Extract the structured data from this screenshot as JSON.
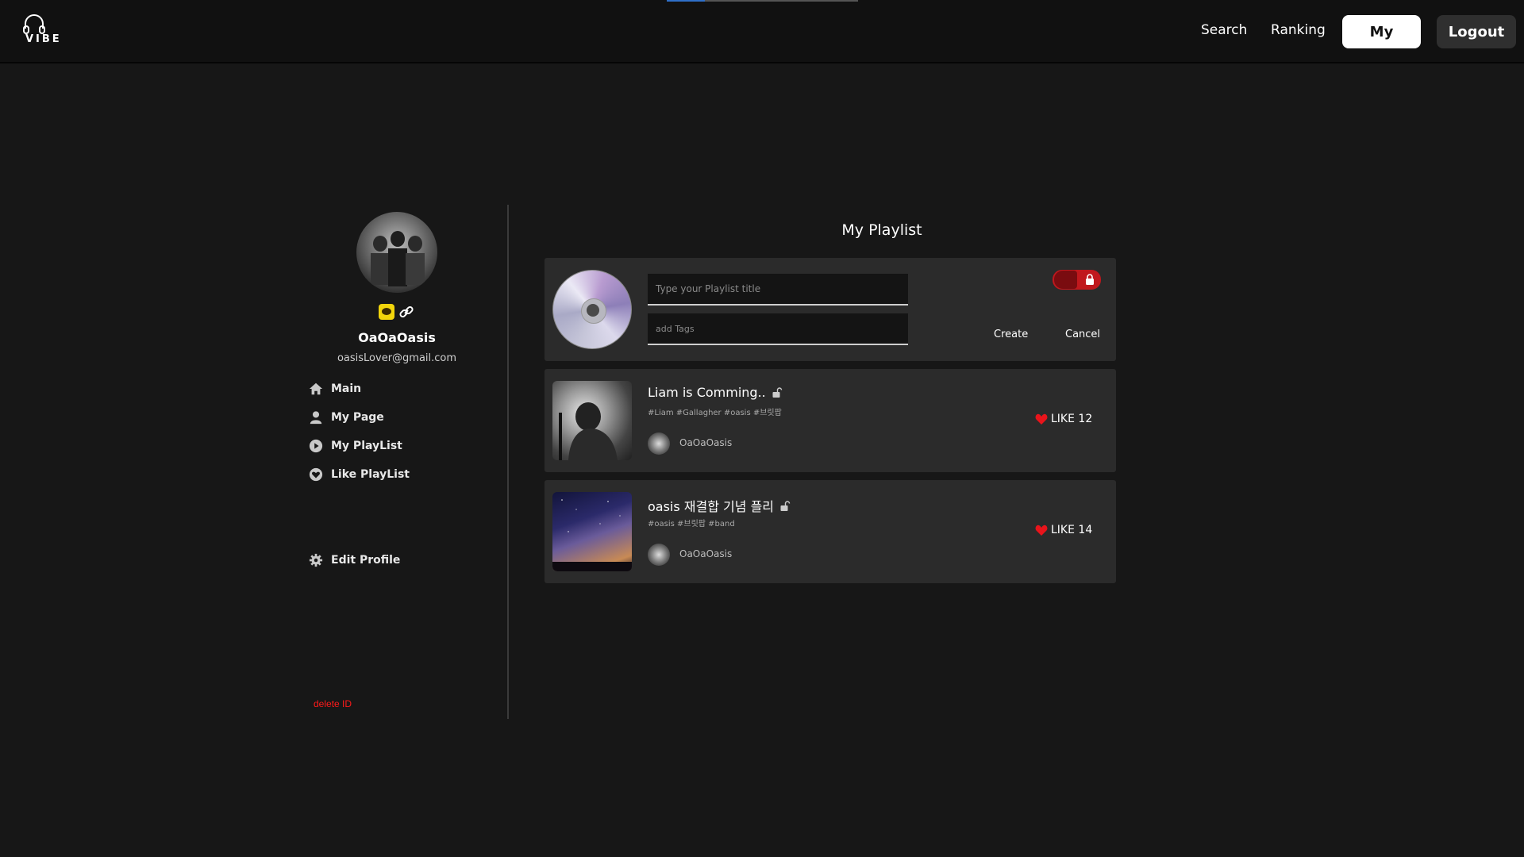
{
  "header": {
    "logo_text": "VIBE",
    "nav": {
      "search": "Search",
      "ranking": "Ranking",
      "my": "My",
      "logout": "Logout"
    },
    "top_progress": 0.2
  },
  "profile": {
    "name": "OaOaOasis",
    "email": "oasisLover@gmail.com"
  },
  "sidebar": {
    "items": [
      {
        "label": "Main",
        "icon": "home-icon"
      },
      {
        "label": "My Page",
        "icon": "user-icon"
      },
      {
        "label": "My PlayList",
        "icon": "play-circle-icon"
      },
      {
        "label": "Like PlayList",
        "icon": "heart-circle-icon"
      }
    ],
    "edit_profile": "Edit Profile",
    "delete_id": "delete ID"
  },
  "main": {
    "title": "My Playlist",
    "create": {
      "title_placeholder": "Type your Playlist title",
      "tags_placeholder": "add Tags",
      "create_label": "Create",
      "cancel_label": "Cancel",
      "private": true
    },
    "playlists": [
      {
        "title": "Liam is Comming..",
        "tags": "#Liam #Gallagher #oasis #브릿팝",
        "owner": "OaOaOasis",
        "like_label": "LIKE 12"
      },
      {
        "title": "oasis 재결합 기념 플리",
        "tags": "#oasis #브릿팝 #band",
        "owner": "OaOaOasis",
        "like_label": "LIKE 14"
      }
    ]
  },
  "colors": {
    "accent_red": "#c0181d",
    "delete_red": "#ff1a1a",
    "background": "#171717",
    "card": "#2b2b2b"
  }
}
